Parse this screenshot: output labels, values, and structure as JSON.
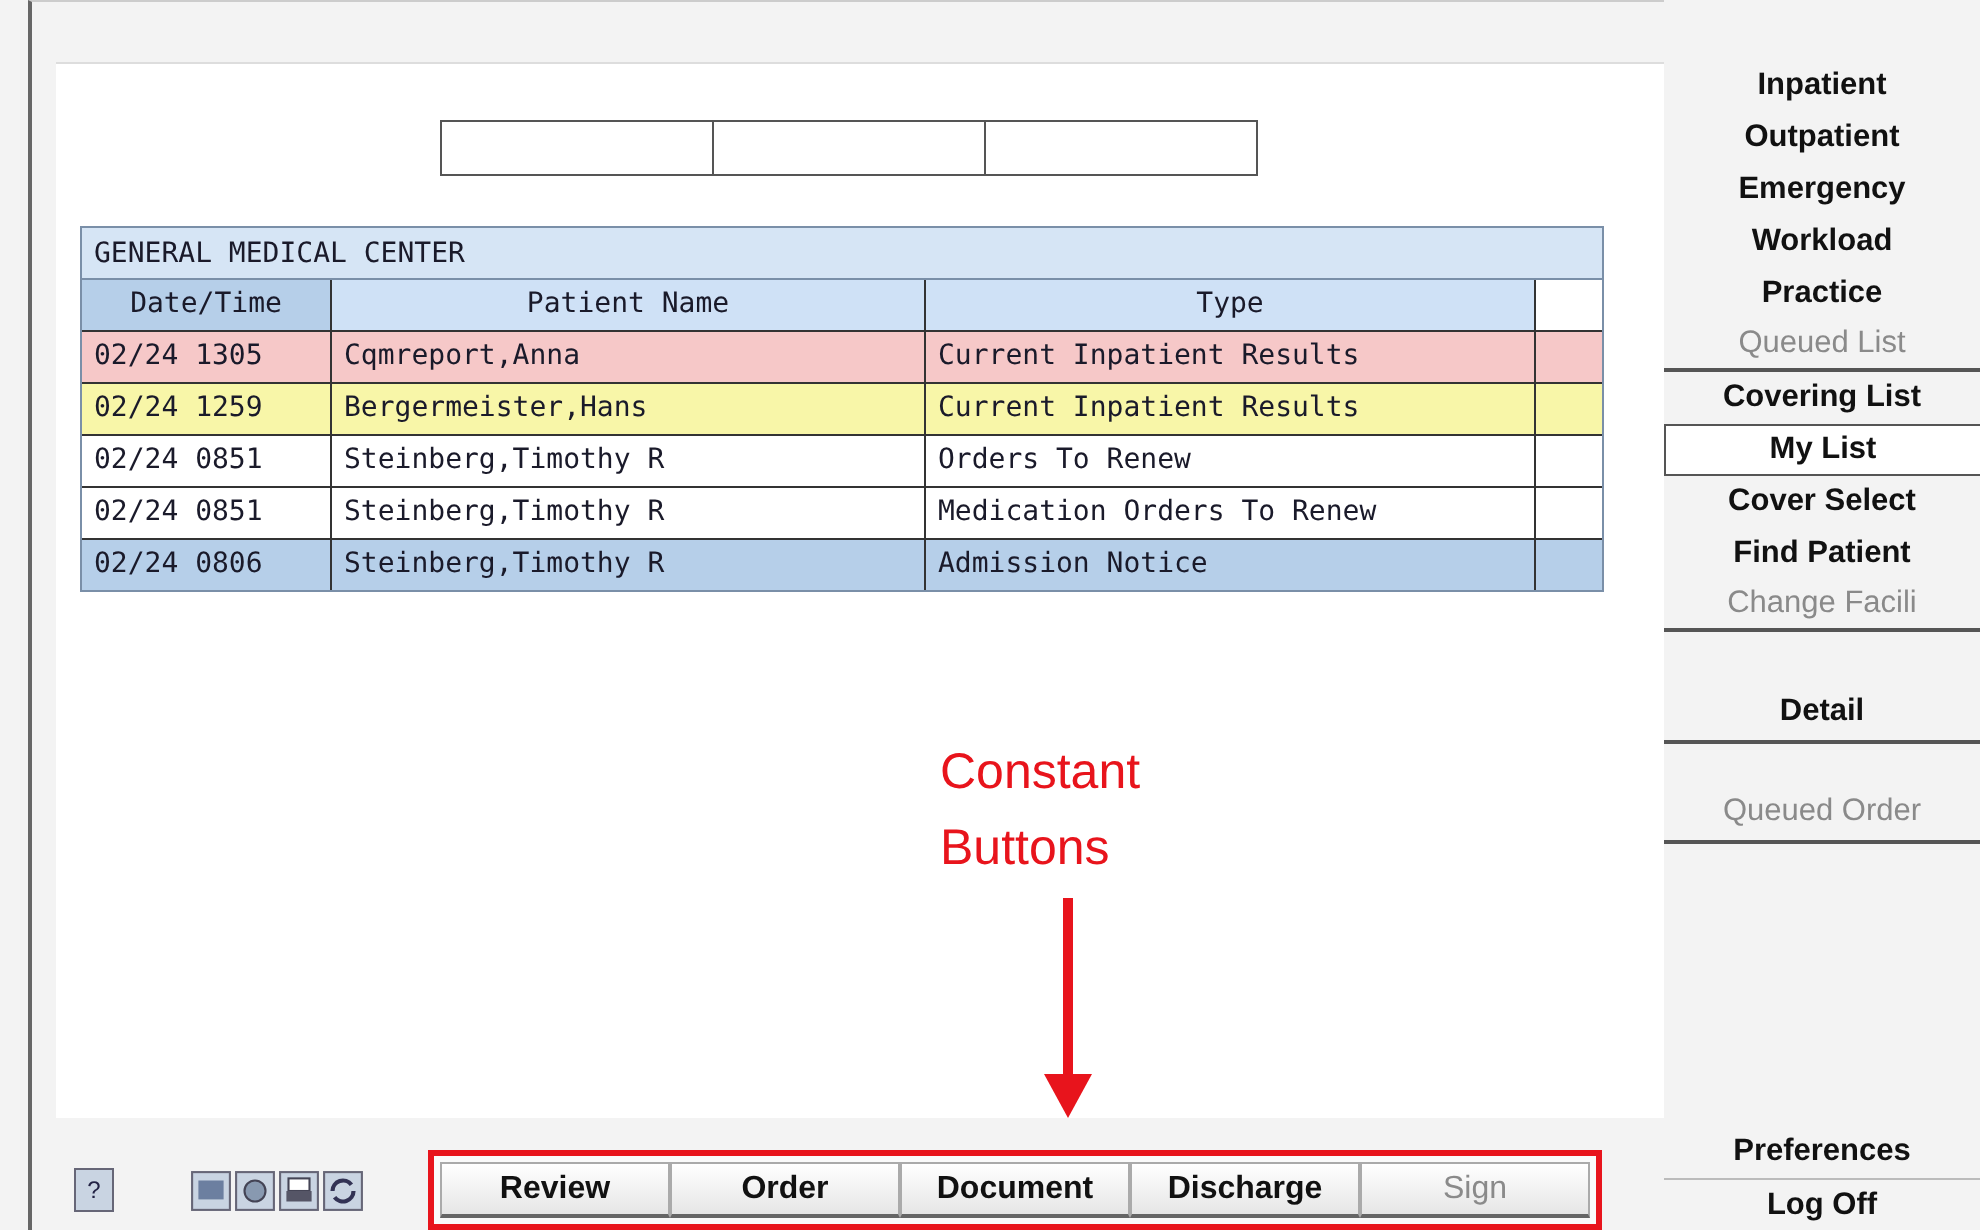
{
  "table": {
    "title": "GENERAL MEDICAL CENTER",
    "columns": [
      "Date/Time",
      "Patient Name",
      "Type"
    ],
    "rows": [
      {
        "cells": [
          "02/24 1305",
          "Cqmreport,Anna",
          "Current Inpatient Results"
        ],
        "color": "#f6c8c8",
        "selected": false
      },
      {
        "cells": [
          "02/24 1259",
          "Bergermeister,Hans",
          "Current Inpatient Results"
        ],
        "color": "#f8f6a8",
        "selected": false
      },
      {
        "cells": [
          "02/24 0851",
          "Steinberg,Timothy R",
          "Orders To Renew"
        ],
        "color": "#ffffff",
        "selected": false
      },
      {
        "cells": [
          "02/24 0851",
          "Steinberg,Timothy R",
          "Medication Orders To Renew"
        ],
        "color": "#ffffff",
        "selected": false
      },
      {
        "cells": [
          "02/24 0806",
          "Steinberg,Timothy R",
          "Admission Notice"
        ],
        "color": "#b6cfe9",
        "selected": false
      }
    ]
  },
  "sidebar": {
    "items": [
      {
        "label": "Inpatient",
        "disabled": false,
        "selected": false
      },
      {
        "label": "Outpatient",
        "disabled": false,
        "selected": false
      },
      {
        "label": "Emergency",
        "disabled": false,
        "selected": false
      },
      {
        "label": "Workload",
        "disabled": false,
        "selected": false
      },
      {
        "label": "Practice",
        "disabled": false,
        "selected": false
      },
      {
        "label": "Queued List",
        "disabled": true,
        "selected": false
      },
      {
        "label": "Covering List",
        "disabled": false,
        "selected": false
      },
      {
        "label": "My List",
        "disabled": false,
        "selected": true
      },
      {
        "label": "Cover Select",
        "disabled": false,
        "selected": false
      },
      {
        "label": "Find Patient",
        "disabled": false,
        "selected": false
      },
      {
        "label": "Change Facili",
        "disabled": true,
        "selected": false
      }
    ],
    "actions": [
      {
        "label": "Detail",
        "disabled": false
      },
      {
        "label": "Queued Order",
        "disabled": true
      }
    ],
    "bottom": [
      "Preferences",
      "Log Off"
    ]
  },
  "annotation": {
    "text": "Constant Buttons"
  },
  "help_button": {
    "label": "?"
  },
  "constant_buttons": [
    {
      "label": "Review",
      "disabled": false
    },
    {
      "label": "Order",
      "disabled": false
    },
    {
      "label": "Document",
      "disabled": false
    },
    {
      "label": "Discharge",
      "disabled": false
    },
    {
      "label": "Sign",
      "disabled": true
    }
  ]
}
